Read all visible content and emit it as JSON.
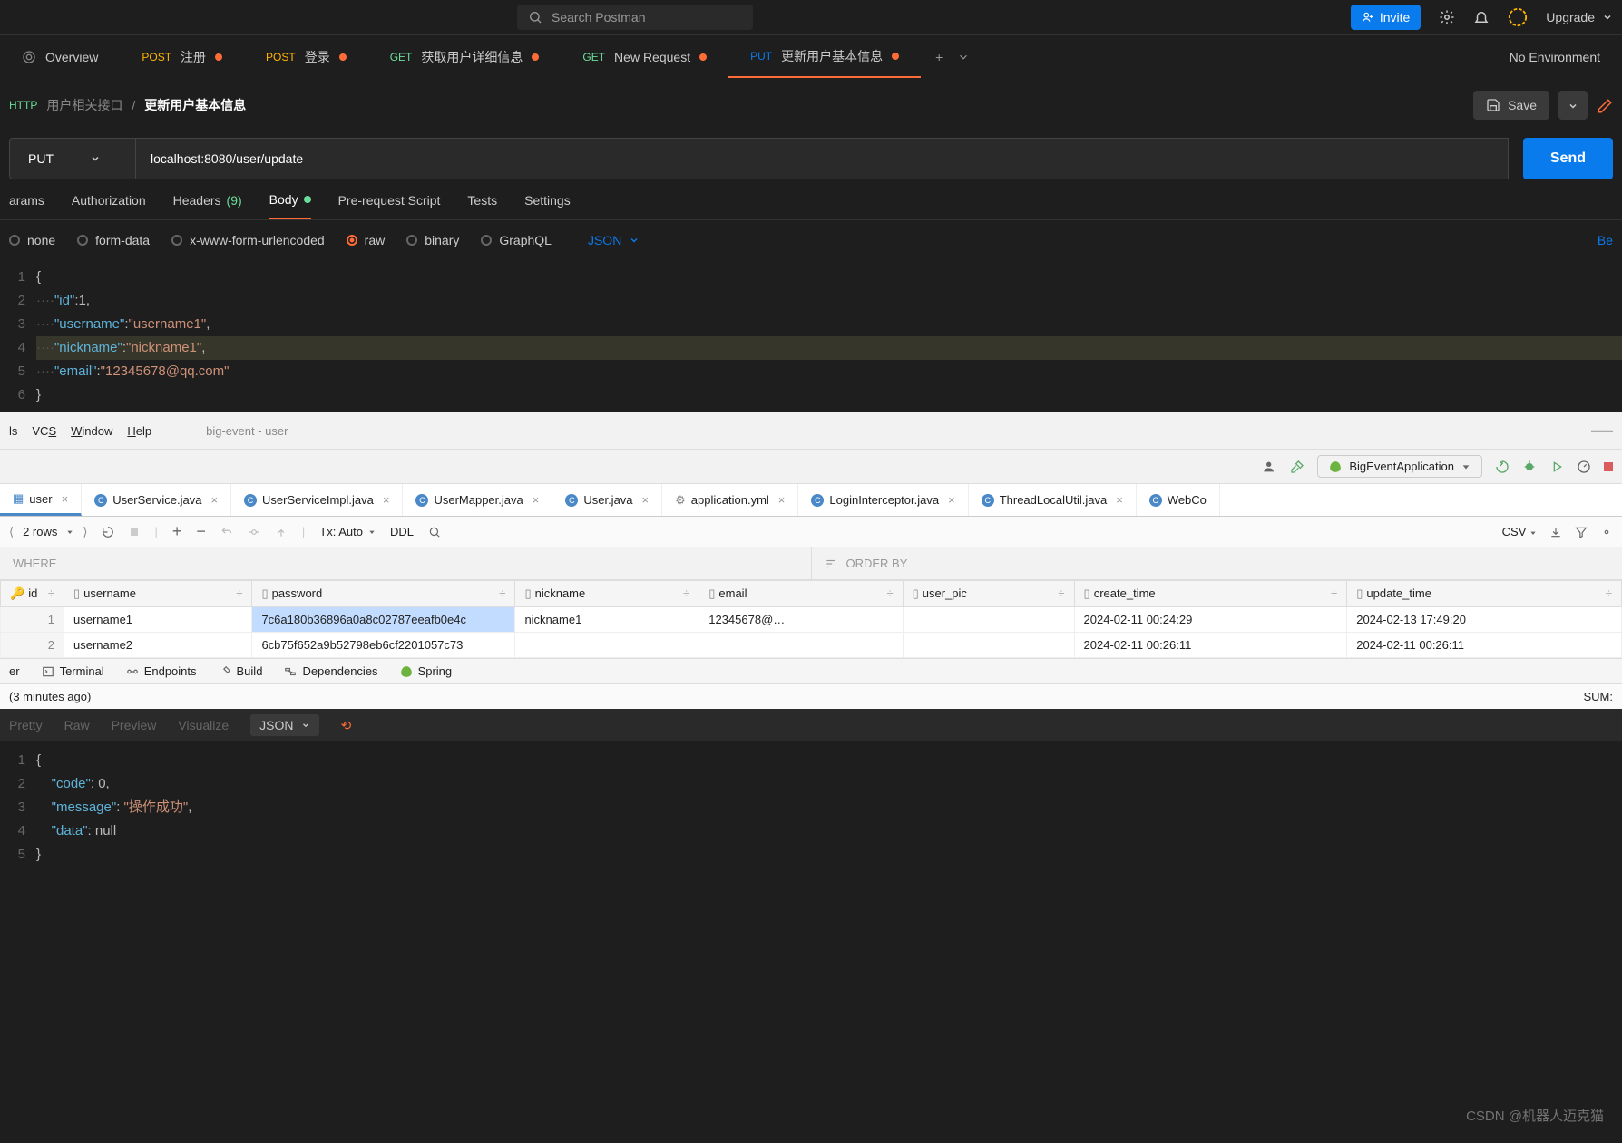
{
  "topbar": {
    "search_placeholder": "Search Postman",
    "invite": "Invite",
    "upgrade": "Upgrade"
  },
  "tabs": {
    "overview": "Overview",
    "items": [
      {
        "method": "POST",
        "label": "注册"
      },
      {
        "method": "POST",
        "label": "登录"
      },
      {
        "method": "GET",
        "label": "获取用户详细信息"
      },
      {
        "method": "GET",
        "label": "New Request"
      },
      {
        "method": "PUT",
        "label": "更新用户基本信息"
      }
    ],
    "no_env": "No Environment"
  },
  "header": {
    "http": "HTTP",
    "group": "用户相关接口",
    "name": "更新用户基本信息",
    "save": "Save"
  },
  "request": {
    "method": "PUT",
    "url": "localhost:8080/user/update",
    "send": "Send"
  },
  "req_tabs": {
    "params": "arams",
    "auth": "Authorization",
    "headers": "Headers",
    "headers_count": "(9)",
    "body": "Body",
    "prereq": "Pre-request Script",
    "tests": "Tests",
    "settings": "Settings"
  },
  "body_types": {
    "none": "none",
    "formdata": "form-data",
    "xwww": "x-www-form-urlencoded",
    "raw": "raw",
    "binary": "binary",
    "graphql": "GraphQL",
    "json": "JSON"
  },
  "body_code": {
    "l1": "{",
    "l2_key": "\"id\"",
    "l2_val": "1",
    "l3_key": "\"username\"",
    "l3_val": "\"username1\"",
    "l4_key": "\"nickname\"",
    "l4_val": "\"nickname1\"",
    "l5_key": "\"email\"",
    "l5_val": "\"12345678@qq.com\"",
    "l6": "}"
  },
  "ij": {
    "menu": {
      "tools": "ls",
      "vcs": "VCS",
      "window": "Window",
      "help": "Help"
    },
    "project": "big-event - user",
    "run_config": "BigEventApplication",
    "file_tabs": [
      {
        "label": "user",
        "type": "db",
        "active": true
      },
      {
        "label": "UserService.java",
        "type": "java"
      },
      {
        "label": "UserServiceImpl.java",
        "type": "java"
      },
      {
        "label": "UserMapper.java",
        "type": "java"
      },
      {
        "label": "User.java",
        "type": "java"
      },
      {
        "label": "application.yml",
        "type": "yml"
      },
      {
        "label": "LoginInterceptor.java",
        "type": "java"
      },
      {
        "label": "ThreadLocalUtil.java",
        "type": "java"
      },
      {
        "label": "WebCo",
        "type": "java"
      }
    ],
    "rows_label": "2 rows",
    "tx": "Tx: Auto",
    "ddl": "DDL",
    "csv": "CSV",
    "where": "WHERE",
    "order": "ORDER BY",
    "columns": [
      "id",
      "username",
      "password",
      "nickname",
      "email",
      "user_pic",
      "create_time",
      "update_time"
    ],
    "rows": [
      {
        "n": "1",
        "id_hidden": "",
        "username": "username1",
        "password": "7c6a180b36896a0a8c02787eeafb0e4c",
        "nickname": "nickname1",
        "email": "12345678@…",
        "user_pic": "",
        "create_time": "2024-02-11 00:24:29",
        "update_time": "2024-02-13 17:49:20"
      },
      {
        "n": "2",
        "id_hidden": "",
        "username": "username2",
        "password": "6cb75f652a9b52798eb6cf2201057c73",
        "nickname": "",
        "email": "",
        "user_pic": "",
        "create_time": "2024-02-11 00:26:11",
        "update_time": "2024-02-11 00:26:11"
      }
    ],
    "bottom_tabs": {
      "terminal": "Terminal",
      "endpoints": "Endpoints",
      "build": "Build",
      "deps": "Dependencies",
      "spring": "Spring"
    },
    "status_left": "(3 minutes ago)",
    "sum": "SUM:"
  },
  "resp": {
    "pretty": "Pretty",
    "raw": "Raw",
    "preview": "Preview",
    "visualize": "Visualize",
    "json": "JSON",
    "l1": "{",
    "l2_key": "\"code\"",
    "l2_val": "0",
    "l3_key": "\"message\"",
    "l3_val": "\"操作成功\"",
    "l4_key": "\"data\"",
    "l4_val": "null",
    "l5": "}"
  },
  "watermark": "CSDN @机器人迈克猫"
}
